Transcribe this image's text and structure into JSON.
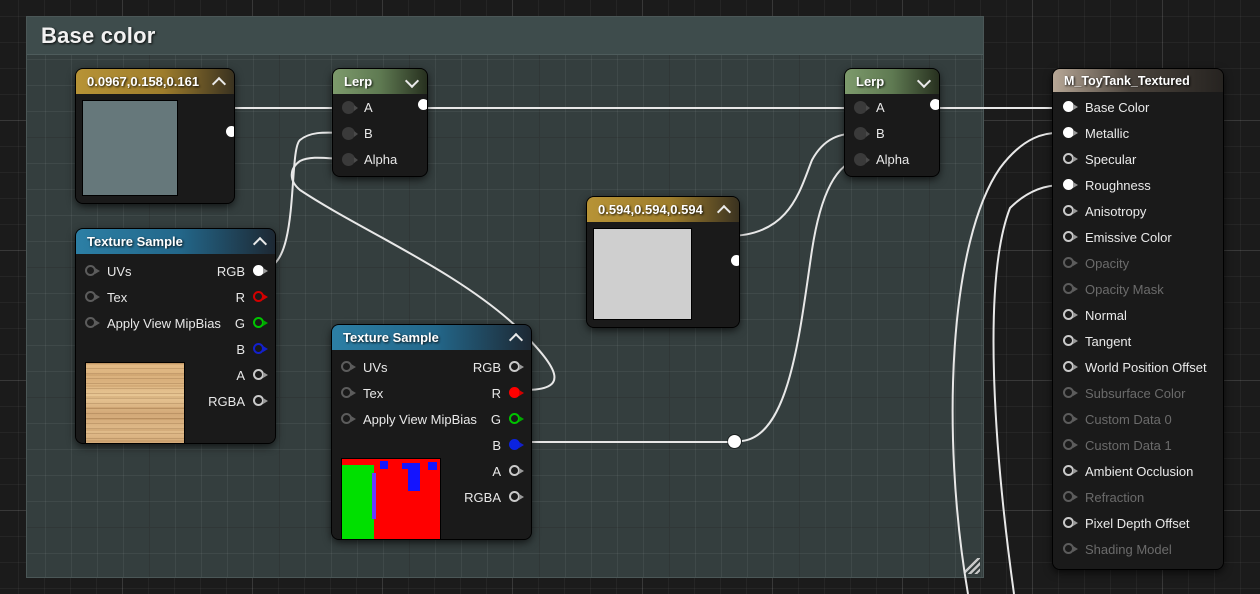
{
  "comment": {
    "title": "Base color",
    "resize_handle": "resize-grip"
  },
  "nodes": {
    "const_basecolor": {
      "title": "0.0967,0.158,0.161",
      "swatch_color": "#66787b",
      "collapse_icon": "chevron-up-icon",
      "output_pin": "output"
    },
    "const_grey": {
      "title": "0.594,0.594,0.594",
      "swatch_color": "#cfcfcf",
      "collapse_icon": "chevron-up-icon",
      "output_pin": "output"
    },
    "lerp_1": {
      "title": "Lerp",
      "collapse_icon": "chevron-down-icon",
      "inputs": [
        "A",
        "B",
        "Alpha"
      ],
      "output": ""
    },
    "lerp_2": {
      "title": "Lerp",
      "collapse_icon": "chevron-down-icon",
      "inputs": [
        "A",
        "B",
        "Alpha"
      ],
      "output": ""
    },
    "texture_wood": {
      "title": "Texture Sample",
      "collapse_icon": "chevron-up-icon",
      "inputs": [
        "UVs",
        "Tex",
        "Apply View MipBias"
      ],
      "outputs": [
        "RGB",
        "R",
        "G",
        "B",
        "A",
        "RGBA"
      ]
    },
    "texture_mask": {
      "title": "Texture Sample",
      "collapse_icon": "chevron-up-icon",
      "inputs": [
        "UVs",
        "Tex",
        "Apply View MipBias"
      ],
      "outputs": [
        "RGB",
        "R",
        "G",
        "B",
        "A",
        "RGBA"
      ]
    },
    "material": {
      "title": "M_ToyTank_Textured",
      "pins": [
        {
          "label": "Base Color",
          "connected": true,
          "disabled": false
        },
        {
          "label": "Metallic",
          "connected": true,
          "disabled": false
        },
        {
          "label": "Specular",
          "connected": false,
          "disabled": false
        },
        {
          "label": "Roughness",
          "connected": true,
          "disabled": false
        },
        {
          "label": "Anisotropy",
          "connected": false,
          "disabled": false
        },
        {
          "label": "Emissive Color",
          "connected": false,
          "disabled": false
        },
        {
          "label": "Opacity",
          "connected": false,
          "disabled": true
        },
        {
          "label": "Opacity Mask",
          "connected": false,
          "disabled": true
        },
        {
          "label": "Normal",
          "connected": false,
          "disabled": false
        },
        {
          "label": "Tangent",
          "connected": false,
          "disabled": false
        },
        {
          "label": "World Position Offset",
          "connected": false,
          "disabled": false
        },
        {
          "label": "Subsurface Color",
          "connected": false,
          "disabled": true
        },
        {
          "label": "Custom Data 0",
          "connected": false,
          "disabled": true
        },
        {
          "label": "Custom Data 1",
          "connected": false,
          "disabled": true
        },
        {
          "label": "Ambient Occlusion",
          "connected": false,
          "disabled": false
        },
        {
          "label": "Refraction",
          "connected": false,
          "disabled": true
        },
        {
          "label": "Pixel Depth Offset",
          "connected": false,
          "disabled": false
        },
        {
          "label": "Shading Model",
          "connected": false,
          "disabled": true
        }
      ]
    }
  },
  "colors": {
    "wire": "#e8e8e8",
    "header_gold": "#b79336",
    "header_green": "#7d9a6c",
    "header_blue": "#2c7fa5",
    "header_material": "#b7a796",
    "pin_red": "#ff0000",
    "pin_green": "#00c400",
    "pin_blue": "#0b23e0",
    "comment_fill": "#343e3e",
    "canvas": "#1b1b1b"
  }
}
